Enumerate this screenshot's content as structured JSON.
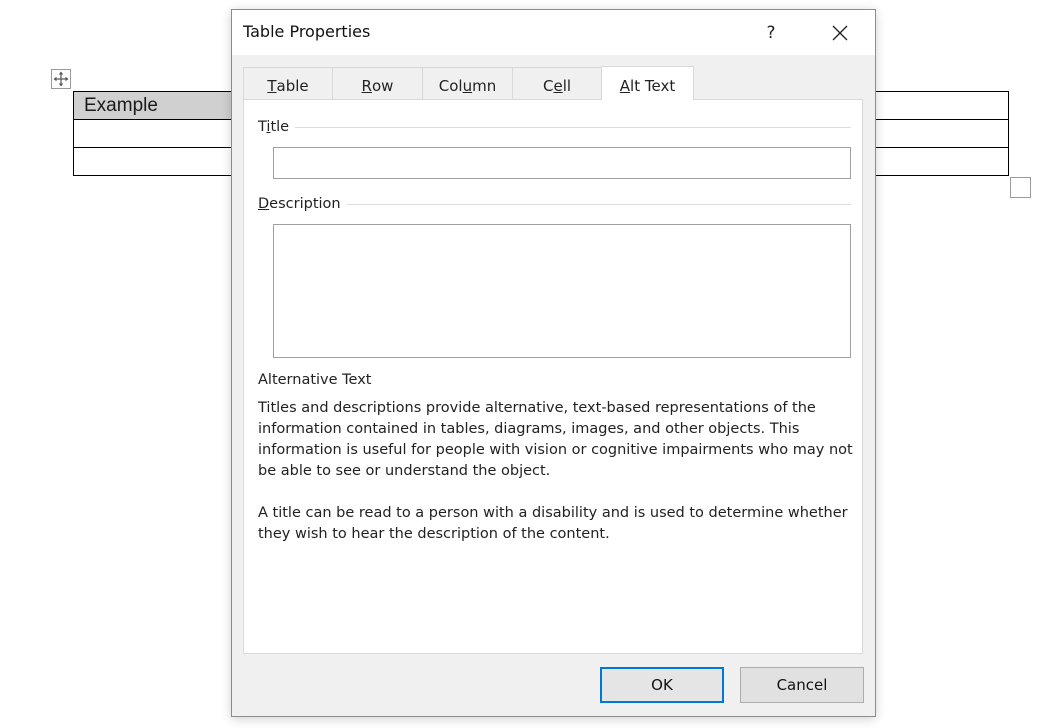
{
  "document": {
    "table_cell_text": "Example"
  },
  "dialog": {
    "title": "Table Properties",
    "help_label": "?",
    "tabs": [
      {
        "pre": "",
        "u": "T",
        "post": "able"
      },
      {
        "pre": "",
        "u": "R",
        "post": "ow"
      },
      {
        "pre": "Col",
        "u": "u",
        "post": "mn"
      },
      {
        "pre": "C",
        "u": "e",
        "post": "ll"
      },
      {
        "pre": "",
        "u": "A",
        "post": "lt Text"
      }
    ],
    "active_tab_index": 4,
    "alt_text": {
      "title_label": {
        "pre": "T",
        "u": "i",
        "post": "tle"
      },
      "title_value": "",
      "description_label": {
        "pre": "",
        "u": "D",
        "post": "escription"
      },
      "description_value": "",
      "heading": "Alternative Text",
      "paragraph1": "Titles and descriptions provide alternative, text-based representations of the information contained in tables, diagrams, images, and other objects. This information is useful for people with vision or cognitive impairments who may not be able to see or understand the object.",
      "paragraph2": "A title can be read to a person with a disability and is used to determine whether they wish to hear the description of the content."
    },
    "buttons": {
      "ok_label": "OK",
      "cancel_label": "Cancel"
    },
    "colors": {
      "accent": "#0078d7",
      "dialog_bg": "#f0f0f0",
      "panel_bg": "#ffffff"
    }
  },
  "icons": {
    "move_handle": "move-arrows-icon",
    "close": "close-x-icon"
  }
}
